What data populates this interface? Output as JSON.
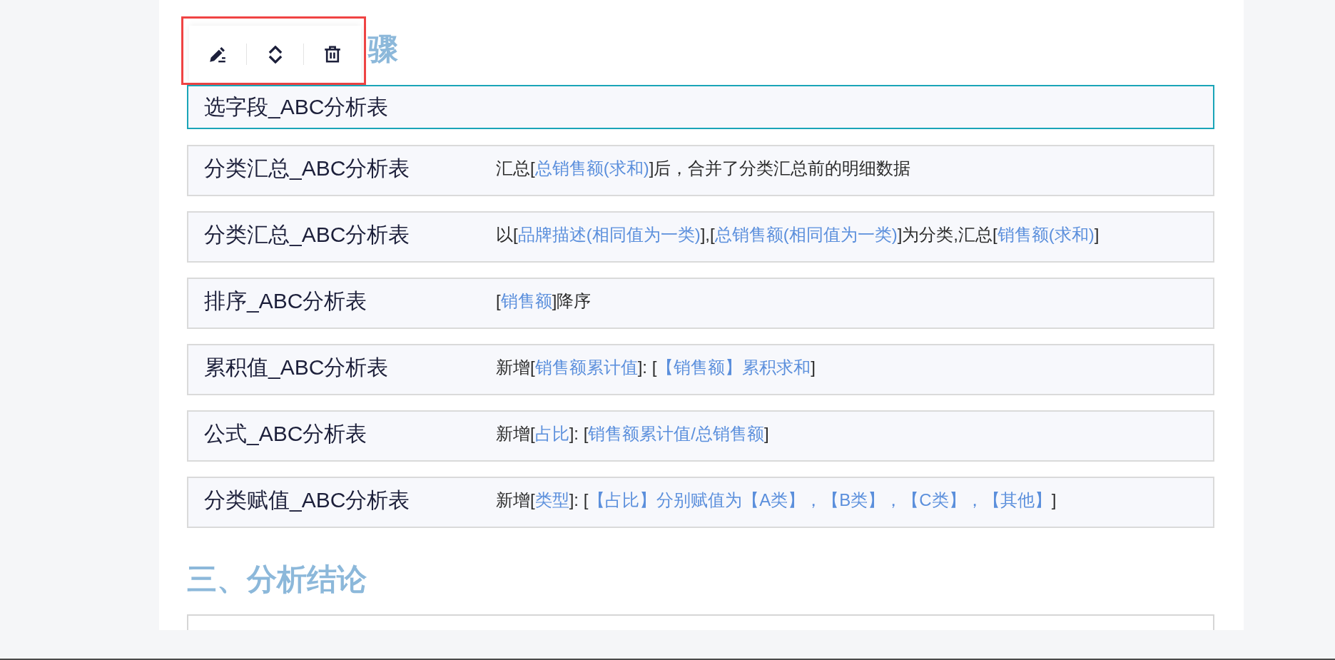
{
  "steps_section": {
    "heading": "骤",
    "steps": [
      {
        "title": "选字段_ABC分析表",
        "selected": true
      },
      {
        "title": "分类汇总_ABC分析表",
        "selected": false,
        "description": [
          {
            "kind": "plain",
            "text": "汇总["
          },
          {
            "kind": "field",
            "text": "总销售额(求和)"
          },
          {
            "kind": "plain",
            "text": "]后，合并了分类汇总前的明细数据"
          }
        ]
      },
      {
        "title": "分类汇总_ABC分析表",
        "selected": false,
        "description": [
          {
            "kind": "plain",
            "text": "以["
          },
          {
            "kind": "field",
            "text": "品牌描述(相同值为一类)"
          },
          {
            "kind": "plain",
            "text": "],["
          },
          {
            "kind": "field",
            "text": "总销售额(相同值为一类)"
          },
          {
            "kind": "plain",
            "text": "]为分类,汇总["
          },
          {
            "kind": "field",
            "text": "销售额(求和)"
          },
          {
            "kind": "plain",
            "text": "]"
          }
        ]
      },
      {
        "title": "排序_ABC分析表",
        "selected": false,
        "description": [
          {
            "kind": "plain",
            "text": "["
          },
          {
            "kind": "field",
            "text": "销售额"
          },
          {
            "kind": "plain",
            "text": "]降序"
          }
        ]
      },
      {
        "title": "累积值_ABC分析表",
        "selected": false,
        "description": [
          {
            "kind": "plain",
            "text": "新增["
          },
          {
            "kind": "field",
            "text": "销售额累计值"
          },
          {
            "kind": "plain",
            "text": "]: ["
          },
          {
            "kind": "field",
            "text": "【销售额】累积求和"
          },
          {
            "kind": "plain",
            "text": "]"
          }
        ]
      },
      {
        "title": "公式_ABC分析表",
        "selected": false,
        "description": [
          {
            "kind": "plain",
            "text": "新增["
          },
          {
            "kind": "field",
            "text": "占比"
          },
          {
            "kind": "plain",
            "text": "]: ["
          },
          {
            "kind": "field",
            "text": "销售额累计值/总销售额"
          },
          {
            "kind": "plain",
            "text": "]"
          }
        ]
      },
      {
        "title": "分类赋值_ABC分析表",
        "selected": false,
        "description": [
          {
            "kind": "plain",
            "text": "新增["
          },
          {
            "kind": "field",
            "text": "类型"
          },
          {
            "kind": "plain",
            "text": "]: ["
          },
          {
            "kind": "field",
            "text": "【占比】分别赋值为【A类】，【B类】，【C类】，【其他】"
          },
          {
            "kind": "plain",
            "text": "]"
          }
        ]
      }
    ]
  },
  "conclusion_section": {
    "heading": "三、分析结论"
  }
}
